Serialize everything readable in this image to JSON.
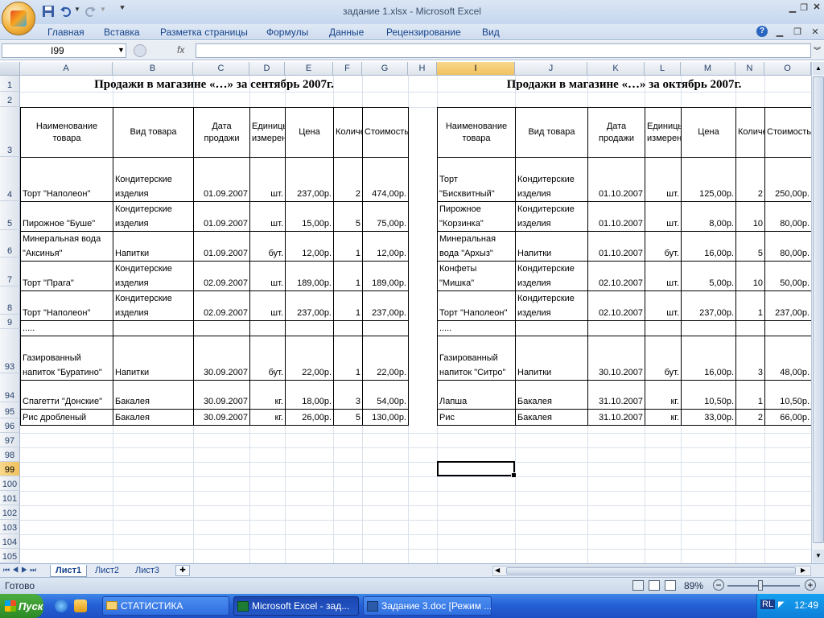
{
  "window": {
    "title": "задание 1.xlsx - Microsoft Excel"
  },
  "ribbon": {
    "tabs": [
      "Главная",
      "Вставка",
      "Разметка страницы",
      "Формулы",
      "Данные",
      "Рецензирование",
      "Вид"
    ]
  },
  "formula_bar": {
    "name_box": "I99",
    "fx": "fx",
    "value": ""
  },
  "columns": [
    "A",
    "B",
    "C",
    "D",
    "E",
    "F",
    "G",
    "H",
    "I",
    "J",
    "K",
    "L",
    "M",
    "N",
    "O"
  ],
  "rows": [
    "1",
    "2",
    "3",
    "4",
    "5",
    "6",
    "7",
    "8",
    "9",
    "93",
    "94",
    "95",
    "96",
    "97",
    "98",
    "99",
    "100",
    "101",
    "102",
    "103",
    "104",
    "105"
  ],
  "sept": {
    "title": "Продажи в магазине «…» за сентябрь 2007г.",
    "headers": [
      "Наименование товара",
      "Вид товара",
      "Дата продажи",
      "Единицы измерения",
      "Цена",
      "Количество",
      "Стоимость"
    ],
    "rows": [
      [
        "Торт \"Наполеон\"",
        "Кондитерские изделия",
        "01.09.2007",
        "шт.",
        "237,00р.",
        "2",
        "474,00р."
      ],
      [
        "Пирожное \"Буше\"",
        "Кондитерские изделия",
        "01.09.2007",
        "шт.",
        "15,00р.",
        "5",
        "75,00р."
      ],
      [
        "Минеральная вода \"Аксинья\"",
        "Напитки",
        "01.09.2007",
        "бут.",
        "12,00р.",
        "1",
        "12,00р."
      ],
      [
        "Торт \"Прага\"",
        "Кондитерские изделия",
        "02.09.2007",
        "шт.",
        "189,00р.",
        "1",
        "189,00р."
      ],
      [
        "Торт \"Наполеон\"",
        "Кондитерские изделия",
        "02.09.2007",
        "шт.",
        "237,00р.",
        "1",
        "237,00р."
      ],
      [
        ".....",
        "",
        "",
        "",
        "",
        "",
        ""
      ],
      [
        "Газированный напиток \"Буратино\"",
        "Напитки",
        "30.09.2007",
        "бут.",
        "22,00р.",
        "1",
        "22,00р."
      ],
      [
        "Спагетти \"Донские\"",
        "Бакалея",
        "30.09.2007",
        "кг.",
        "18,00р.",
        "3",
        "54,00р."
      ],
      [
        "Рис дробленый",
        "Бакалея",
        "30.09.2007",
        "кг.",
        "26,00р.",
        "5",
        "130,00р."
      ]
    ]
  },
  "oct": {
    "title": "Продажи в магазине «…» за октябрь 2007г.",
    "headers": [
      "Наименование товара",
      "Вид товара",
      "Дата продажи",
      "Единицы измерения",
      "Цена",
      "Количество",
      "Стоимость"
    ],
    "rows": [
      [
        "Торт \"Бисквитный\"",
        "Кондитерские изделия",
        "01.10.2007",
        "шт.",
        "125,00р.",
        "2",
        "250,00р."
      ],
      [
        "Пирожное \"Корзинка\"",
        "Кондитерские изделия",
        "01.10.2007",
        "шт.",
        "8,00р.",
        "10",
        "80,00р."
      ],
      [
        "Минеральная вода \"Архыз\"",
        "Напитки",
        "01.10.2007",
        "бут.",
        "16,00р.",
        "5",
        "80,00р."
      ],
      [
        "Конфеты \"Мишка\"",
        "Кондитерские изделия",
        "02.10.2007",
        "шт.",
        "5,00р.",
        "10",
        "50,00р."
      ],
      [
        "Торт \"Наполеон\"",
        "Кондитерские изделия",
        "02.10.2007",
        "шт.",
        "237,00р.",
        "1",
        "237,00р."
      ],
      [
        ".....",
        "",
        "",
        "",
        "",
        "",
        ""
      ],
      [
        "Газированный напиток \"Ситро\"",
        "Напитки",
        "30.10.2007",
        "бут.",
        "16,00р.",
        "3",
        "48,00р."
      ],
      [
        "Лапша",
        "Бакалея",
        "31.10.2007",
        "кг.",
        "10,50р.",
        "1",
        "10,50р."
      ],
      [
        "Рис",
        "Бакалея",
        "31.10.2007",
        "кг.",
        "33,00р.",
        "2",
        "66,00р."
      ]
    ]
  },
  "sheet_tabs": [
    "Лист1",
    "Лист2",
    "Лист3"
  ],
  "status": {
    "ready": "Готово",
    "zoom": "89%"
  },
  "taskbar": {
    "start": "Пуск",
    "buttons": [
      "СТАТИСТИКА",
      "Microsoft Excel - зад...",
      "Задание 3.doc [Режим ..."
    ],
    "lang": "RL",
    "clock": "12:49"
  }
}
